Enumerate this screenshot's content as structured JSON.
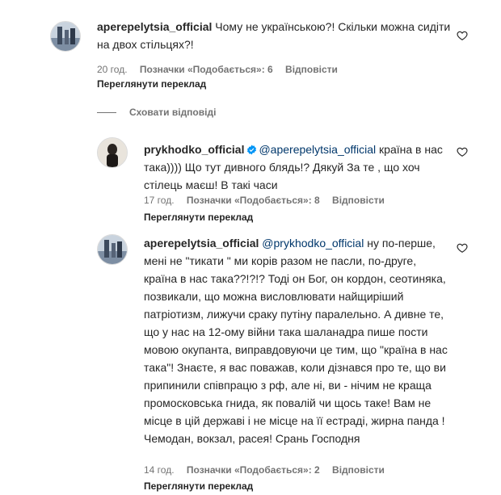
{
  "comments": [
    {
      "username": "aperepelytsia_official",
      "mention": "",
      "text": " Чому не українською?! Скільки можна сидіти на двох стільцях?!",
      "time": "20 год.",
      "likes": "Позначки «Подобається»: 6",
      "reply": "Відповісти",
      "translate": "Переглянути переклад"
    },
    {
      "username": "prykhodko_official",
      "mention": "@aperepelytsia_official",
      "text": " країна в нас така)))) Що тут дивного блядь!? Дякуй За те , що хоч стілець маєш! В такі часи",
      "time": "17 год.",
      "likes": "Позначки «Подобається»: 8",
      "reply": "Відповісти",
      "translate": "Переглянути переклад"
    },
    {
      "username": "aperepelytsia_official",
      "mention": "@prykhodko_official",
      "text": " ну по-перше, мені не \"тикати \" ми корів разом не пасли, по-друге, країна в нас така??!?!? Тоді он Бог, он кордон, сеотиняка, позвикали, що можна висловлювати найщиріший патріотизм, лижучи сраку путіну паралельно. А дивне те, що у нас на 12-ому війни така шаланадра пише пости мовою окупанта, виправдовуючи це тим, що \"країна в нас така\"! Знаєте, я вас поважав, коли дізнався про те, що ви припинили співпрацю з рф, але ні, ви - нічим не краща промосковська гнида, як повалій чи щось таке! Вам не місце в цій державі і не місце на її естраді, жирна панда ! Чемодан, вокзал, расея! Срань Господня",
      "time": "14 год.",
      "likes": "Позначки «Подобається»: 2",
      "reply": "Відповісти",
      "translate": "Переглянути переклад"
    }
  ],
  "hide_replies": "Сховати відповіді",
  "icons": {
    "like": "heart-icon",
    "verified": "verified-badge-icon"
  },
  "colors": {
    "text": "#262626",
    "secondary": "#737373",
    "mention": "#00376b",
    "verified": "#0095f6"
  }
}
